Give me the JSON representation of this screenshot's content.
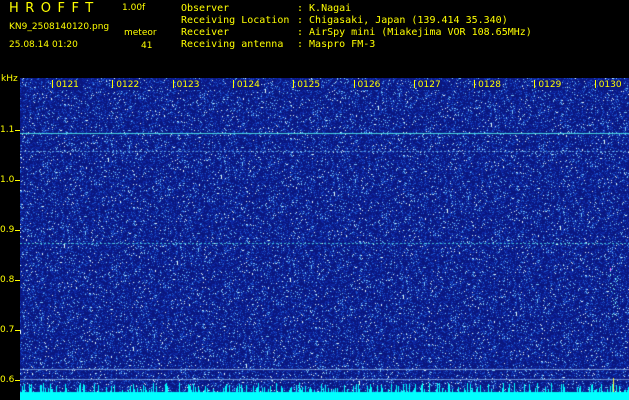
{
  "app": {
    "name": "HROFFT",
    "version": "1.00f"
  },
  "file": {
    "name": "KN9_2508140120.png",
    "timestamp": "25.08.14 01:20"
  },
  "meteor": {
    "label": "meteor",
    "count": "41"
  },
  "observer_labels": [
    "Observer",
    "Receiving Location",
    "Receiver",
    "Receiving antenna"
  ],
  "observer_values": [
    ": K.Nagai",
    ": Chigasaki, Japan (139.414 35.340)",
    ": AirSpy mini (Miakejima VOR 108.65MHz)",
    ": Maspro FM-3"
  ],
  "y_axis": {
    "unit": "kHz",
    "ticks": [
      "1.1",
      "1.0",
      "0.9",
      "0.8",
      "0.7",
      "0.6"
    ]
  },
  "minute_labels": [
    "0121",
    "0122",
    "0123",
    "0124",
    "0125",
    "0126",
    "0127",
    "0128",
    "0129",
    "0130"
  ],
  "colors": {
    "background": "#000000",
    "waterfall": "#0a1780",
    "text": "#ffff00",
    "signal": "#00ffff"
  }
}
